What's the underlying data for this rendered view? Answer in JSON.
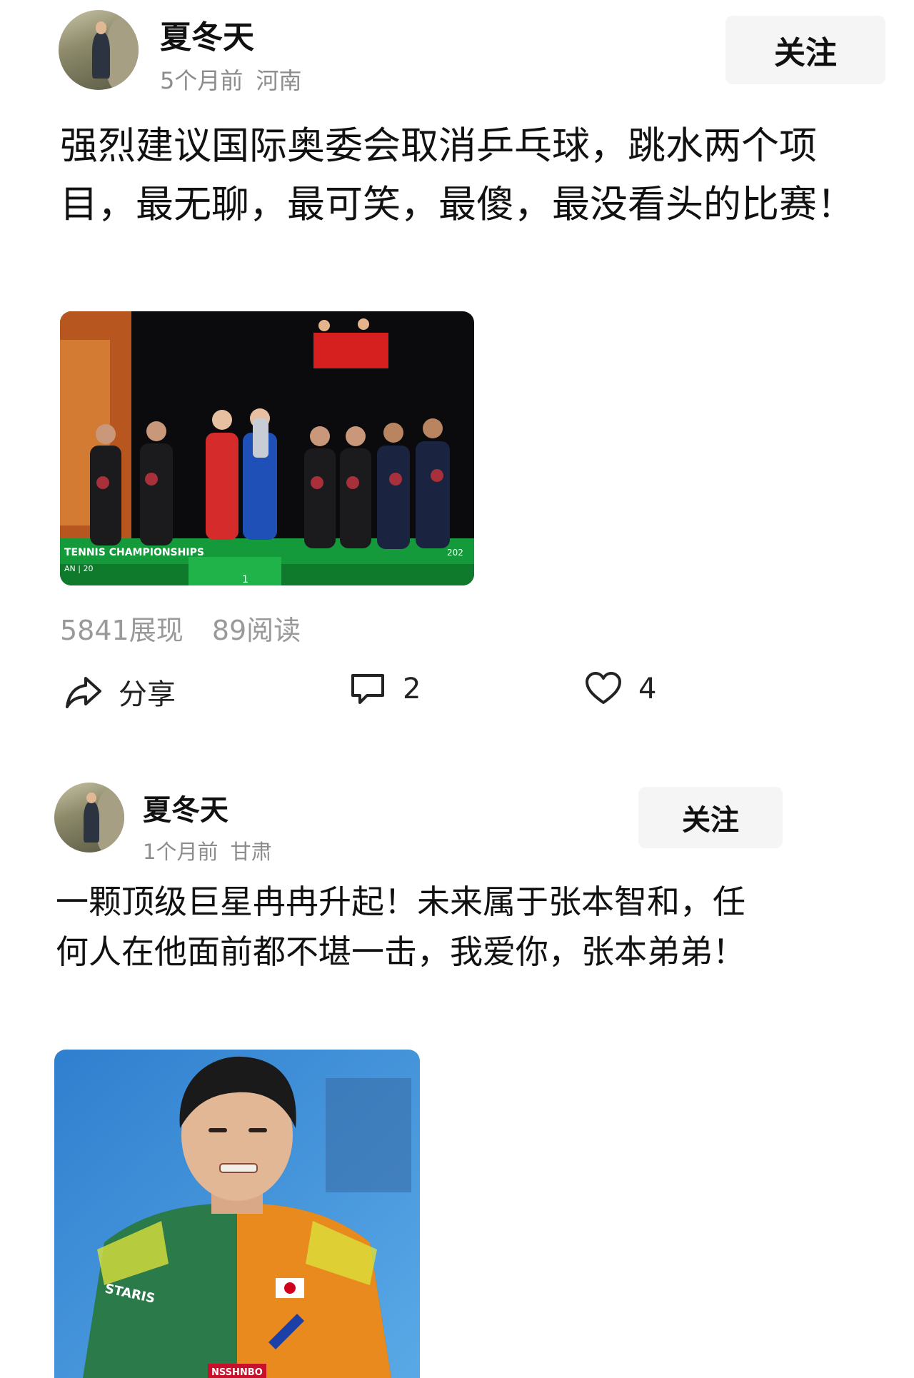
{
  "posts": [
    {
      "username": "夏冬天",
      "time": "5个月前",
      "location": "河南",
      "follow_label": "关注",
      "content": "强烈建议国际奥委会取消乒乓球，跳水两个项目，最无聊，最可笑，最傻，最没看头的比赛！",
      "image_text": "TENNIS CHAMPIONSHIPS",
      "image_subtext": "AN | 20",
      "image_year": "202",
      "podium_number": "1",
      "stats": {
        "impressions": "5841展现",
        "reads": "89阅读"
      },
      "actions": {
        "share_label": "分享",
        "comment_count": "2",
        "like_count": "4"
      }
    },
    {
      "username": "夏冬天",
      "time": "1个月前",
      "location": "甘肃",
      "follow_label": "关注",
      "content": "一颗顶级巨星冉冉升起！未来属于张本智和，任何人在他面前都不堪一击，我爱你，张本弟弟！",
      "image_logo_text": "NSSHNBO",
      "image_brand_text": "STARIS"
    }
  ],
  "colors": {
    "text": "#111111",
    "meta": "#8c8c8c",
    "stats": "#999999",
    "follow_bg": "#f5f5f5"
  }
}
